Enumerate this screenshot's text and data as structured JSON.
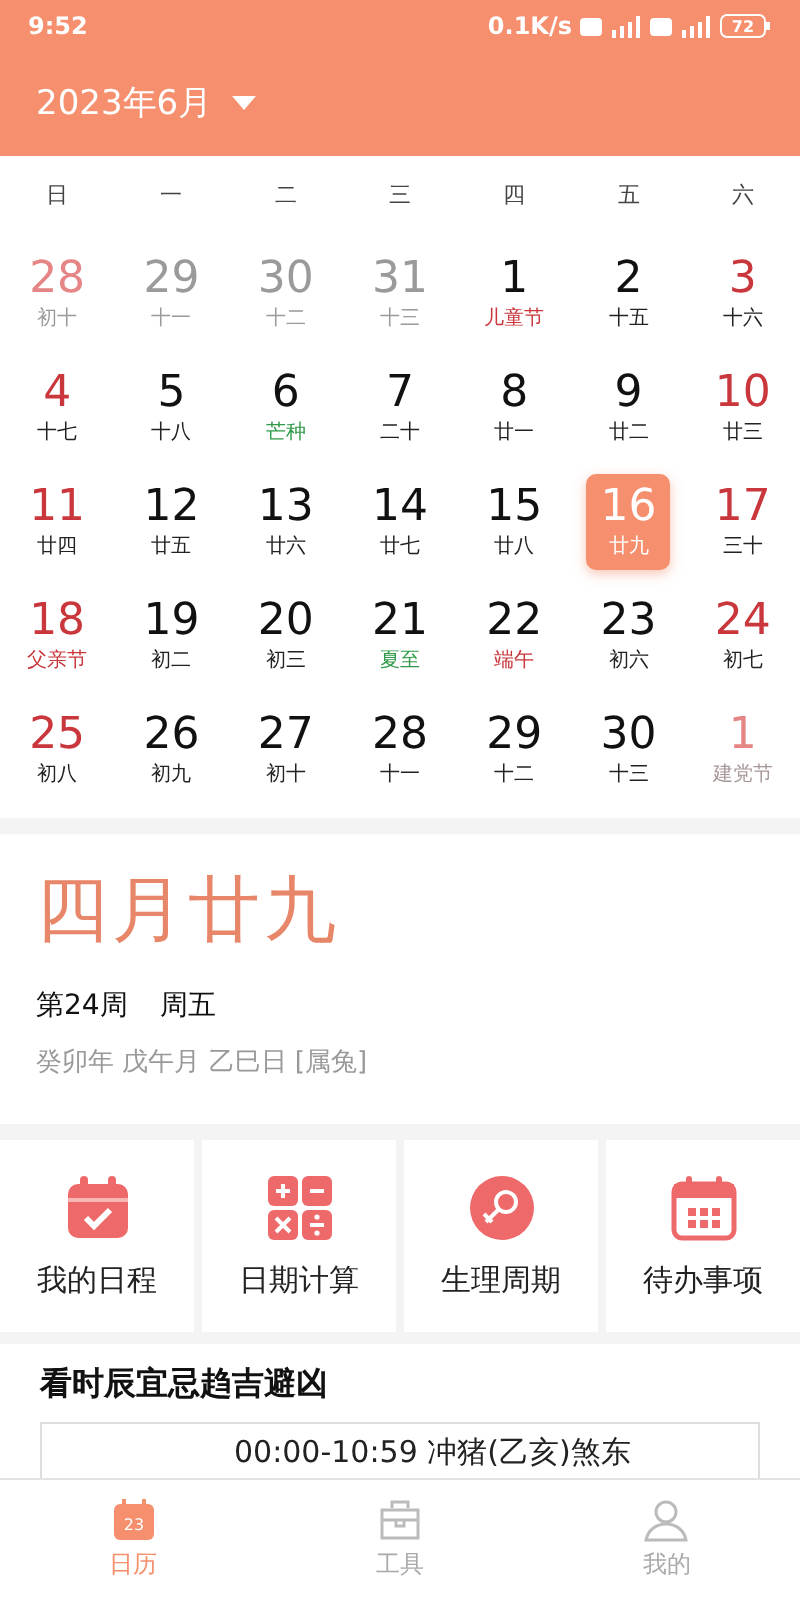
{
  "status_bar": {
    "time": "9:52",
    "speed": "0.1K/s",
    "battery": "72"
  },
  "header": {
    "month": "2023年6月"
  },
  "weekdays": [
    "日",
    "一",
    "二",
    "三",
    "四",
    "五",
    "六"
  ],
  "weeks": [
    [
      {
        "day": "28",
        "note": "初十",
        "in_month": false,
        "weekend": true,
        "kind": "lunar",
        "selected": false
      },
      {
        "day": "29",
        "note": "十一",
        "in_month": false,
        "weekend": false,
        "kind": "lunar",
        "selected": false
      },
      {
        "day": "30",
        "note": "十二",
        "in_month": false,
        "weekend": false,
        "kind": "lunar",
        "selected": false
      },
      {
        "day": "31",
        "note": "十三",
        "in_month": false,
        "weekend": false,
        "kind": "lunar",
        "selected": false
      },
      {
        "day": "1",
        "note": "儿童节",
        "in_month": true,
        "weekend": false,
        "kind": "festival",
        "selected": false
      },
      {
        "day": "2",
        "note": "十五",
        "in_month": true,
        "weekend": false,
        "kind": "lunar",
        "selected": false
      },
      {
        "day": "3",
        "note": "十六",
        "in_month": true,
        "weekend": true,
        "kind": "lunar",
        "selected": false
      }
    ],
    [
      {
        "day": "4",
        "note": "十七",
        "in_month": true,
        "weekend": true,
        "kind": "lunar",
        "selected": false
      },
      {
        "day": "5",
        "note": "十八",
        "in_month": true,
        "weekend": false,
        "kind": "lunar",
        "selected": false
      },
      {
        "day": "6",
        "note": "芒种",
        "in_month": true,
        "weekend": false,
        "kind": "term",
        "selected": false
      },
      {
        "day": "7",
        "note": "二十",
        "in_month": true,
        "weekend": false,
        "kind": "lunar",
        "selected": false
      },
      {
        "day": "8",
        "note": "廿一",
        "in_month": true,
        "weekend": false,
        "kind": "lunar",
        "selected": false
      },
      {
        "day": "9",
        "note": "廿二",
        "in_month": true,
        "weekend": false,
        "kind": "lunar",
        "selected": false
      },
      {
        "day": "10",
        "note": "廿三",
        "in_month": true,
        "weekend": true,
        "kind": "lunar",
        "selected": false
      }
    ],
    [
      {
        "day": "11",
        "note": "廿四",
        "in_month": true,
        "weekend": true,
        "kind": "lunar",
        "selected": false
      },
      {
        "day": "12",
        "note": "廿五",
        "in_month": true,
        "weekend": false,
        "kind": "lunar",
        "selected": false
      },
      {
        "day": "13",
        "note": "廿六",
        "in_month": true,
        "weekend": false,
        "kind": "lunar",
        "selected": false
      },
      {
        "day": "14",
        "note": "廿七",
        "in_month": true,
        "weekend": false,
        "kind": "lunar",
        "selected": false
      },
      {
        "day": "15",
        "note": "廿八",
        "in_month": true,
        "weekend": false,
        "kind": "lunar",
        "selected": false
      },
      {
        "day": "16",
        "note": "廿九",
        "in_month": true,
        "weekend": false,
        "kind": "lunar",
        "selected": true
      },
      {
        "day": "17",
        "note": "三十",
        "in_month": true,
        "weekend": true,
        "kind": "lunar",
        "selected": false
      }
    ],
    [
      {
        "day": "18",
        "note": "父亲节",
        "in_month": true,
        "weekend": true,
        "kind": "festival",
        "selected": false
      },
      {
        "day": "19",
        "note": "初二",
        "in_month": true,
        "weekend": false,
        "kind": "lunar",
        "selected": false
      },
      {
        "day": "20",
        "note": "初三",
        "in_month": true,
        "weekend": false,
        "kind": "lunar",
        "selected": false
      },
      {
        "day": "21",
        "note": "夏至",
        "in_month": true,
        "weekend": false,
        "kind": "term",
        "selected": false
      },
      {
        "day": "22",
        "note": "端午",
        "in_month": true,
        "weekend": false,
        "kind": "festival",
        "selected": false
      },
      {
        "day": "23",
        "note": "初六",
        "in_month": true,
        "weekend": false,
        "kind": "lunar",
        "selected": false
      },
      {
        "day": "24",
        "note": "初七",
        "in_month": true,
        "weekend": true,
        "kind": "lunar",
        "selected": false
      }
    ],
    [
      {
        "day": "25",
        "note": "初八",
        "in_month": true,
        "weekend": true,
        "kind": "lunar",
        "selected": false
      },
      {
        "day": "26",
        "note": "初九",
        "in_month": true,
        "weekend": false,
        "kind": "lunar",
        "selected": false
      },
      {
        "day": "27",
        "note": "初十",
        "in_month": true,
        "weekend": false,
        "kind": "lunar",
        "selected": false
      },
      {
        "day": "28",
        "note": "十一",
        "in_month": true,
        "weekend": false,
        "kind": "lunar",
        "selected": false
      },
      {
        "day": "29",
        "note": "十二",
        "in_month": true,
        "weekend": false,
        "kind": "lunar",
        "selected": false
      },
      {
        "day": "30",
        "note": "十三",
        "in_month": true,
        "weekend": false,
        "kind": "lunar",
        "selected": false
      },
      {
        "day": "1",
        "note": "建党节",
        "in_month": false,
        "weekend": true,
        "kind": "festival",
        "selected": false
      }
    ]
  ],
  "lunar": {
    "date": "四月廿九",
    "week": "第24周",
    "weekday": "周五",
    "ganzhi": "癸卯年 戊午月 乙巳日 [属兔]"
  },
  "tools": [
    {
      "kind": "schedule",
      "label": "我的日程"
    },
    {
      "kind": "calculator",
      "label": "日期计算"
    },
    {
      "kind": "cycle",
      "label": "生理周期"
    },
    {
      "kind": "todo",
      "label": "待办事项"
    }
  ],
  "hours": {
    "title": "看时辰宜忌趋吉避凶",
    "first_row": "00:00-10:59 冲猪(乙亥)煞东"
  },
  "tabs": [
    {
      "kind": "calendar",
      "label": "日历",
      "selected": true,
      "icon_text": "23"
    },
    {
      "kind": "tools",
      "label": "工具",
      "selected": false
    },
    {
      "kind": "profile",
      "label": "我的",
      "selected": false
    }
  ]
}
